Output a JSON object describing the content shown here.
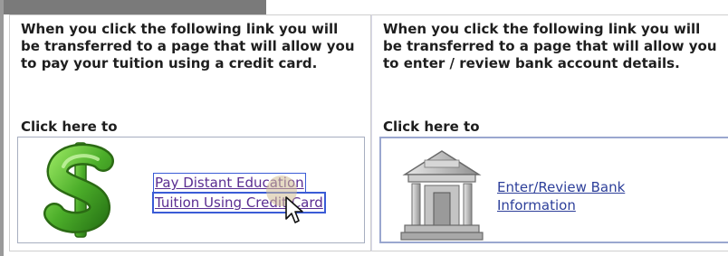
{
  "left_option": {
    "description": "When you click the following link you will be transferred to a page that will allow you to pay your tuition using a credit card.",
    "click_label": "Click here to",
    "link_line1": "Pay Distant Education",
    "link_line2": "Tuition Using Credit Card",
    "icon": "dollar-icon"
  },
  "right_option": {
    "description": "When you click the following link you will be transferred to a page that will allow you to enter / review bank account details.",
    "click_label": "Click here to",
    "link_line1": "Enter/Review Bank",
    "link_line2": "Information",
    "icon": "bank-icon"
  },
  "colors": {
    "visited_link": "#5a2d91",
    "link": "#2d3f9a",
    "focus_outline": "#3a5bd6",
    "dollar_green": "#4cae2a"
  }
}
